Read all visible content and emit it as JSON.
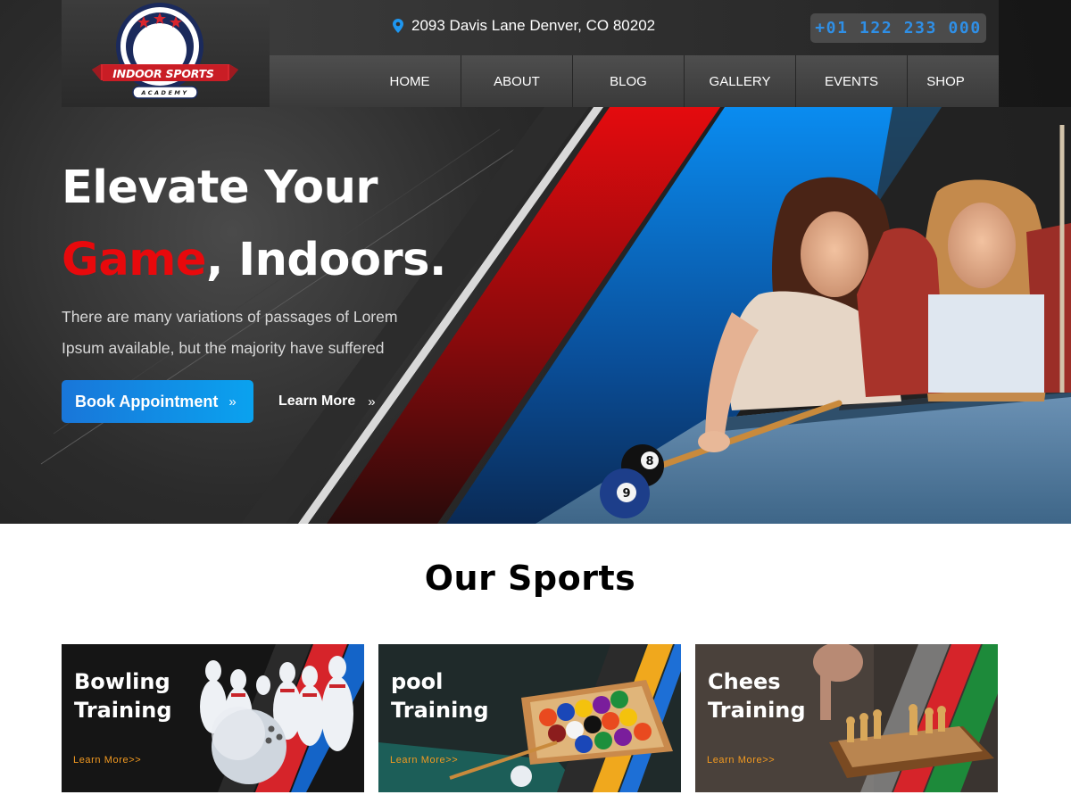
{
  "brand": {
    "logo_title": "INDOOR SPORTS",
    "logo_subtitle": "ACADEMY"
  },
  "topbar": {
    "address": "2093 Davis Lane Denver, CO 80202",
    "address_icon": "map-pin-icon",
    "phone": "+01 122 233 000"
  },
  "nav": {
    "items": [
      {
        "label": "HOME"
      },
      {
        "label": "ABOUT"
      },
      {
        "label": "BLOG"
      },
      {
        "label": "GALLERY"
      },
      {
        "label": "EVENTS"
      },
      {
        "label": "SHOP"
      }
    ]
  },
  "hero": {
    "title_line1": "Elevate Your",
    "title_highlight": "Game",
    "title_rest": ", Indoors.",
    "description": "There are many variations of passages of Lorem Ipsum available, but the majority have suffered",
    "primary_button": "Book Appointment",
    "secondary_button": "Learn More",
    "chevron": "»",
    "ball_numbers": [
      "8",
      "9"
    ]
  },
  "sports": {
    "title": "Our Sports",
    "cards": [
      {
        "line1": "Bowling",
        "line2": "Training",
        "link": "Learn More>>"
      },
      {
        "line1": "pool",
        "line2": "Training",
        "link": "Learn More>>"
      },
      {
        "line1": "Chees",
        "line2": "Training",
        "link": "Learn More>>"
      }
    ]
  },
  "colors": {
    "accent_red": "#e8090c",
    "accent_blue": "#0a84e8",
    "link_orange": "#f29a21",
    "hero_bg": "#1c1c1c"
  }
}
